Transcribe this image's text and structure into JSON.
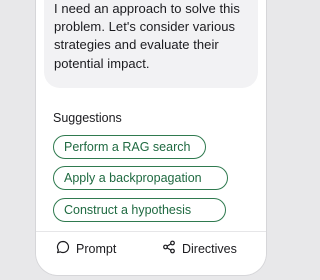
{
  "message": {
    "text": "I need an approach to solve this problem. Let's consider various strategies and evaluate their potential impact."
  },
  "suggestions": {
    "title": "Suggestions",
    "items": [
      {
        "label": "Perform a RAG search"
      },
      {
        "label": "Apply a backpropagation"
      },
      {
        "label": "Construct a hypothesis"
      }
    ]
  },
  "bottom_bar": {
    "prompt": {
      "label": "Prompt",
      "icon": "chat-bubble-icon"
    },
    "directives": {
      "label": "Directives",
      "icon": "share-icon"
    }
  },
  "colors": {
    "accent": "#1f6a41",
    "chip_border": "#2f7a4f",
    "bubble": "#f2f2f4",
    "background": "#e8e8ea"
  }
}
